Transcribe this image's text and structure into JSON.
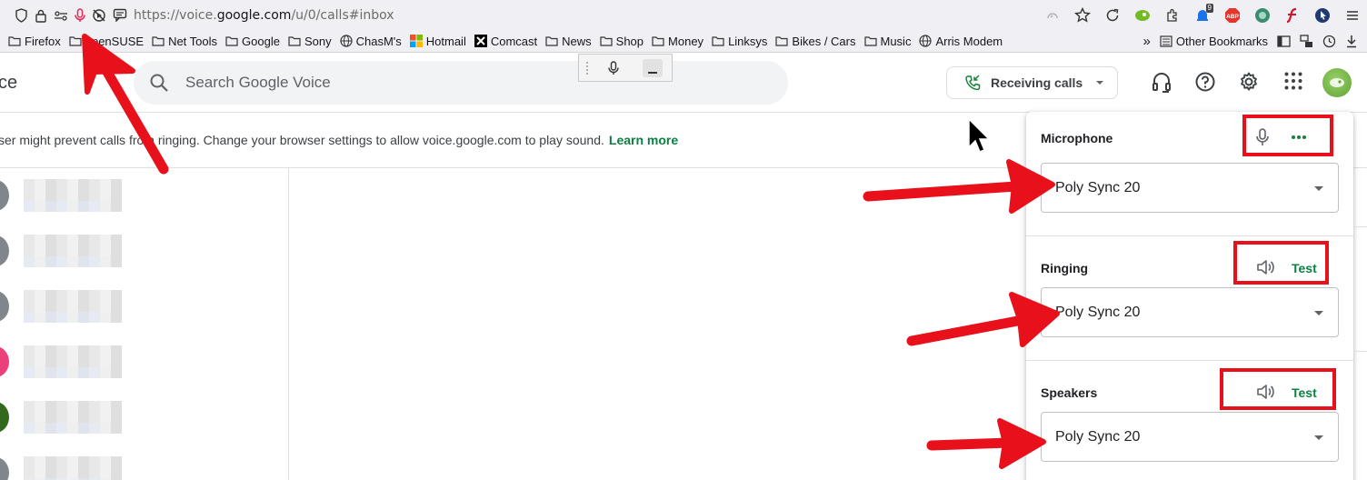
{
  "browser": {
    "url_prefix": "https://voice.",
    "url_domain": "google.com",
    "url_suffix": "/u/0/calls#inbox",
    "extension_badge": "9",
    "bookmarks": [
      "Firefox",
      "openSUSE",
      "Net Tools",
      "Google",
      "Sony",
      "ChasM's",
      "Hotmail",
      "Comcast",
      "News",
      "Shop",
      "Money",
      "Linksys",
      "Bikes / Cars",
      "Music",
      "Arris Modem"
    ],
    "other_bookmarks": "Other Bookmarks"
  },
  "app": {
    "title_fragment": "ce",
    "search_placeholder": "Search Google Voice",
    "receiving_label": "Receiving calls"
  },
  "banner": {
    "text": "ser might prevent calls from ringing. Change your browser settings to allow voice.google.com to play sound.",
    "link": "Learn more"
  },
  "contacts": {
    "avatar_colors": [
      "#80868b",
      "#80868b",
      "#80868b",
      "#ec407a",
      "#33691e",
      "#80868b"
    ]
  },
  "device_panel": {
    "microphone": {
      "title": "Microphone",
      "device": "Poly Sync 20"
    },
    "ringing": {
      "title": "Ringing",
      "device": "Poly Sync 20",
      "test": "Test"
    },
    "speakers": {
      "title": "Speakers",
      "device": "Poly Sync 20",
      "test": "Test"
    }
  },
  "colors": {
    "annotation_red": "#e8101a",
    "accent_green": "#0b8043"
  }
}
